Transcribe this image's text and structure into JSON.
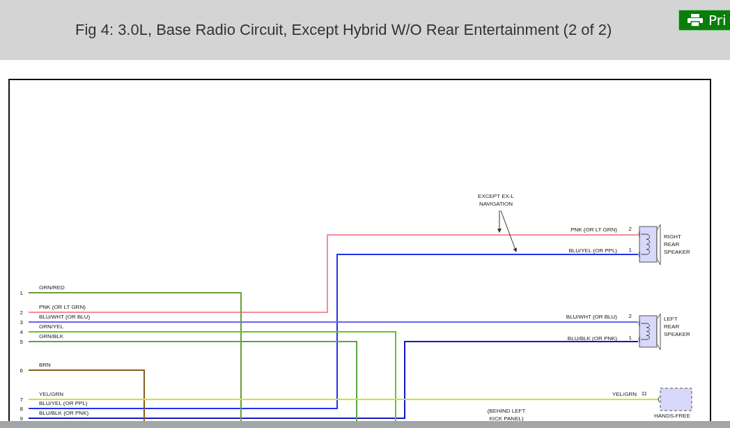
{
  "title": "Fig 4: 3.0L, Base Radio Circuit, Except Hybrid W/O Rear Entertainment (2 of 2)",
  "print_button": {
    "label": "Pri"
  },
  "diagram": {
    "wires": [
      {
        "pin": "1",
        "label": "GRN/RED",
        "color": "#6a9e3a"
      },
      {
        "pin": "2",
        "label": "PNK (OR LT GRN)",
        "color": "#f48c9c",
        "end_label": "PNK (OR LT GRN)",
        "end_pin": "2"
      },
      {
        "pin": "3",
        "label": "BLU/WHT (OR BLU)",
        "color": "#6666f2",
        "end_label": "BLU/WHT (OR BLU)",
        "end_pin": "2"
      },
      {
        "pin": "4",
        "label": "GRN/YEL",
        "color": "#66c425"
      },
      {
        "pin": "5",
        "label": "GRN/BLK",
        "color": "#5aa544"
      },
      {
        "pin": "6",
        "label": "BRN",
        "color": "#85601c"
      },
      {
        "pin": "7",
        "label": "YEL/GRN",
        "color": "#d6e22a",
        "end_label": "YEL/GRN",
        "end_pin": "11"
      },
      {
        "pin": "8",
        "label": "BLU/YEL (OR PPL)",
        "color": "#2233e6",
        "end_label": "BLU/YEL (OR PPL)",
        "end_pin": "1"
      },
      {
        "pin": "9",
        "label": "BLU/BLK (OR PNK)",
        "color": "#1515c8",
        "end_label": "BLU/BLK (OR PNK)",
        "end_pin": "1"
      }
    ],
    "components": [
      {
        "kind": "speaker",
        "lines": [
          "RIGHT",
          "REAR",
          "SPEAKER"
        ]
      },
      {
        "kind": "speaker",
        "lines": [
          "LEFT",
          "REAR",
          "SPEAKER"
        ]
      },
      {
        "kind": "module",
        "lines": [
          "HANDS-FREE"
        ]
      }
    ],
    "notes": [
      {
        "lines": [
          "EXCEPT EX-L",
          "NAVIGATION"
        ]
      },
      {
        "lines": [
          "(BEHIND LEFT",
          "KICK PANEL)"
        ]
      }
    ]
  }
}
